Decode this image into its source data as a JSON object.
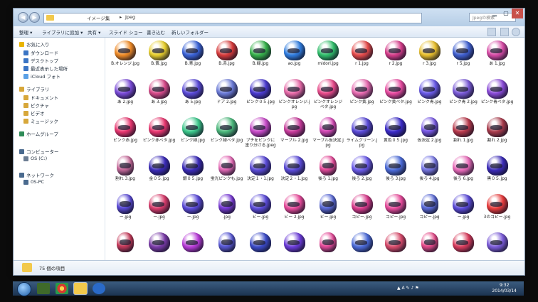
{
  "titlebar": {
    "breadcrumb": [
      "イメージ集",
      "Jpeg"
    ],
    "search_placeholder": "Jpegの検索",
    "controls": [
      "minimize",
      "maximize",
      "close"
    ]
  },
  "toolbar": {
    "items": [
      "整理 ▾",
      "ライブラリに追加 ▾",
      "共有 ▾",
      "スライド ショー",
      "書き込む",
      "新しいフォルダー"
    ]
  },
  "sidebar": {
    "items": [
      {
        "label": "お気に入り",
        "icon": "star-icon",
        "color": "#e9b400"
      },
      {
        "label": "ダウンロード",
        "icon": "download-icon",
        "color": "#3a74c4"
      },
      {
        "label": "デスクトップ",
        "icon": "desktop-icon",
        "color": "#3a74c4"
      },
      {
        "label": "最近表示した場所",
        "icon": "recent-places-icon",
        "color": "#3a74c4"
      },
      {
        "label": "iCloud フォト",
        "icon": "cloud-icon",
        "color": "#5aa0e6"
      },
      {
        "label": "ライブラリ",
        "icon": "library-icon",
        "color": "#d7a73a"
      },
      {
        "label": "ドキュメント",
        "icon": "document-icon",
        "color": "#d7a73a"
      },
      {
        "label": "ピクチャ",
        "icon": "picture-icon",
        "color": "#d7a73a"
      },
      {
        "label": "ビデオ",
        "icon": "video-icon",
        "color": "#d7a73a"
      },
      {
        "label": "ミュージック",
        "icon": "music-icon",
        "color": "#d7a73a"
      },
      {
        "label": "ホームグループ",
        "icon": "homegroup-icon",
        "color": "#2e8b57"
      },
      {
        "label": "コンピューター",
        "icon": "computer-icon",
        "color": "#4a6a8e"
      },
      {
        "label": "OS (C:)",
        "icon": "drive-icon",
        "color": "#6b7d93"
      },
      {
        "label": "ネットワーク",
        "icon": "network-icon",
        "color": "#4a6a8e"
      },
      {
        "label": "0S-PC",
        "icon": "pc-icon",
        "color": "#4a6a8e"
      }
    ]
  },
  "files": [
    {
      "name": "B.オレンジ.jpg",
      "color": "#f08a24"
    },
    {
      "name": "B.黄.jpg",
      "color": "#e8cf2a"
    },
    {
      "name": "B.青.jpg",
      "color": "#3a63d8"
    },
    {
      "name": "B.赤.jpg",
      "color": "#d83a3a"
    },
    {
      "name": "B.緑.jpg",
      "color": "#36b34a"
    },
    {
      "name": "ao.jpg",
      "color": "#2f7de0"
    },
    {
      "name": "midori.jpg",
      "color": "#2fbf6a"
    },
    {
      "name": "r 1.jpg",
      "color": "#e64a4a"
    },
    {
      "name": "r 2.jpg",
      "color": "#d63c8a"
    },
    {
      "name": "r 3.jpg",
      "color": "#e9c02b"
    },
    {
      "name": "r 5.jpg",
      "color": "#3f5fd0"
    },
    {
      "name": "あ 1.jpg",
      "color": "#d84aa6"
    },
    {
      "name": "あ 2.jpg",
      "color": "#7a4ad8"
    },
    {
      "name": "あ 3.jpg",
      "color": "#d84a8a"
    },
    {
      "name": "あ 5.jpg",
      "color": "#5a4ad8"
    },
    {
      "name": "ドア 2.jpg",
      "color": "#6b7bd8"
    },
    {
      "name": "ピンク０５.jpg",
      "color": "#4a3ad0"
    },
    {
      "name": "ピンクオレンジ.jpg",
      "color": "#e86aa8"
    },
    {
      "name": "ピンクオレンジベタ.jpg",
      "color": "#e84a8a"
    },
    {
      "name": "ピンク黄.jpg",
      "color": "#e86ab0"
    },
    {
      "name": "ピンク黄ベタ.jpg",
      "color": "#e84aa0"
    },
    {
      "name": "ピンク青.jpg",
      "color": "#6a5ae8"
    },
    {
      "name": "ピンク青 2.jpg",
      "color": "#7a5ad8"
    },
    {
      "name": "ピンク青ベタ.jpg",
      "color": "#8a4ad8"
    },
    {
      "name": "ピンク赤.jpg",
      "color": "#e8356e"
    },
    {
      "name": "ピンク赤ベタ.jpg",
      "color": "#e8356e"
    },
    {
      "name": "ピンク緑.jpg",
      "color": "#3ac88a"
    },
    {
      "name": "ピンク緑ベタ.jpg",
      "color": "#4ab87a"
    },
    {
      "name": "ブチをピンクに塗り分ける.jpeg",
      "color": "#c84ac8"
    },
    {
      "name": "マーブル 2.jpg",
      "color": "#c83a9a"
    },
    {
      "name": "マーブル仮決定.jpg",
      "color": "#d84ab8"
    },
    {
      "name": "ライムグリーン.jpg",
      "color": "#5a4ad8"
    },
    {
      "name": "黄色０５.jpg",
      "color": "#3a2ac8"
    },
    {
      "name": "仮決定 2.jpg",
      "color": "#7a5ae8"
    },
    {
      "name": "割れ 1.jpg",
      "color": "#b8384a"
    },
    {
      "name": "割れ 2.jpg",
      "color": "#a83a4a"
    },
    {
      "name": "割れ 3.jpg",
      "color": "#c86a9a"
    },
    {
      "name": "金０５.jpg",
      "color": "#3a2ab8"
    },
    {
      "name": "銀０５.jpg",
      "color": "#3a2ab8"
    },
    {
      "name": "蛍光ピンクも.jpg",
      "color": "#e86ab8"
    },
    {
      "name": "決定１・1.jpg",
      "color": "#5a4ad8"
    },
    {
      "name": "決定２・1.jpg",
      "color": "#5a4ad8"
    },
    {
      "name": "後ろ 1.jpg",
      "color": "#e84a9a"
    },
    {
      "name": "後ろ 2.jpg",
      "color": "#6a5ae8"
    },
    {
      "name": "後ろ 3.jpg",
      "color": "#4a6ad8"
    },
    {
      "name": "後ろ 4.jpg",
      "color": "#7a7ae8"
    },
    {
      "name": "後ろ 6.jpg",
      "color": "#e86ab8"
    },
    {
      "name": "黒０５.jpg",
      "color": "#3a2ab8"
    },
    {
      "name": "ー.jpg",
      "color": "#5a4ad8"
    },
    {
      "name": "ー.jpg",
      "color": "#d83a6a"
    },
    {
      "name": "ー.jpg",
      "color": "#5a4ad8"
    },
    {
      "name": ".jpg",
      "color": "#7a3ad8"
    },
    {
      "name": "ビー.jpg",
      "color": "#5a4ad8"
    },
    {
      "name": "ビー 2.jpg",
      "color": "#e84a9a"
    },
    {
      "name": "ビー.jpg",
      "color": "#5a6ad8"
    },
    {
      "name": "コピー.jpg",
      "color": "#d83a8a"
    },
    {
      "name": "コピー.jpg",
      "color": "#e84a9a"
    },
    {
      "name": "コピー.jpg",
      "color": "#5a6ad8"
    },
    {
      "name": "ー.jpg",
      "color": "#5a4ad8"
    },
    {
      "name": "3のコピー.jpg",
      "color": "#e83a3a"
    },
    {
      "name": "",
      "color": "#c83a5a"
    },
    {
      "name": "",
      "color": "#7a3aa8"
    },
    {
      "name": "",
      "color": "#b83ad8"
    },
    {
      "name": "",
      "color": "#5a5ad8"
    },
    {
      "name": "",
      "color": "#3a4ac8"
    },
    {
      "name": "",
      "color": "#6a3ad8"
    },
    {
      "name": "",
      "color": "#e84a9a"
    },
    {
      "name": "",
      "color": "#4a6ad8"
    },
    {
      "name": "",
      "color": "#d84a6a"
    },
    {
      "name": "",
      "color": "#e84a8a"
    },
    {
      "name": "",
      "color": "#d83a5a"
    },
    {
      "name": "",
      "color": "#7a5ad8"
    }
  ],
  "status": {
    "item_count": "75 個の項目"
  },
  "taskbar": {
    "time": "9:32",
    "date": "2014/03/14"
  }
}
